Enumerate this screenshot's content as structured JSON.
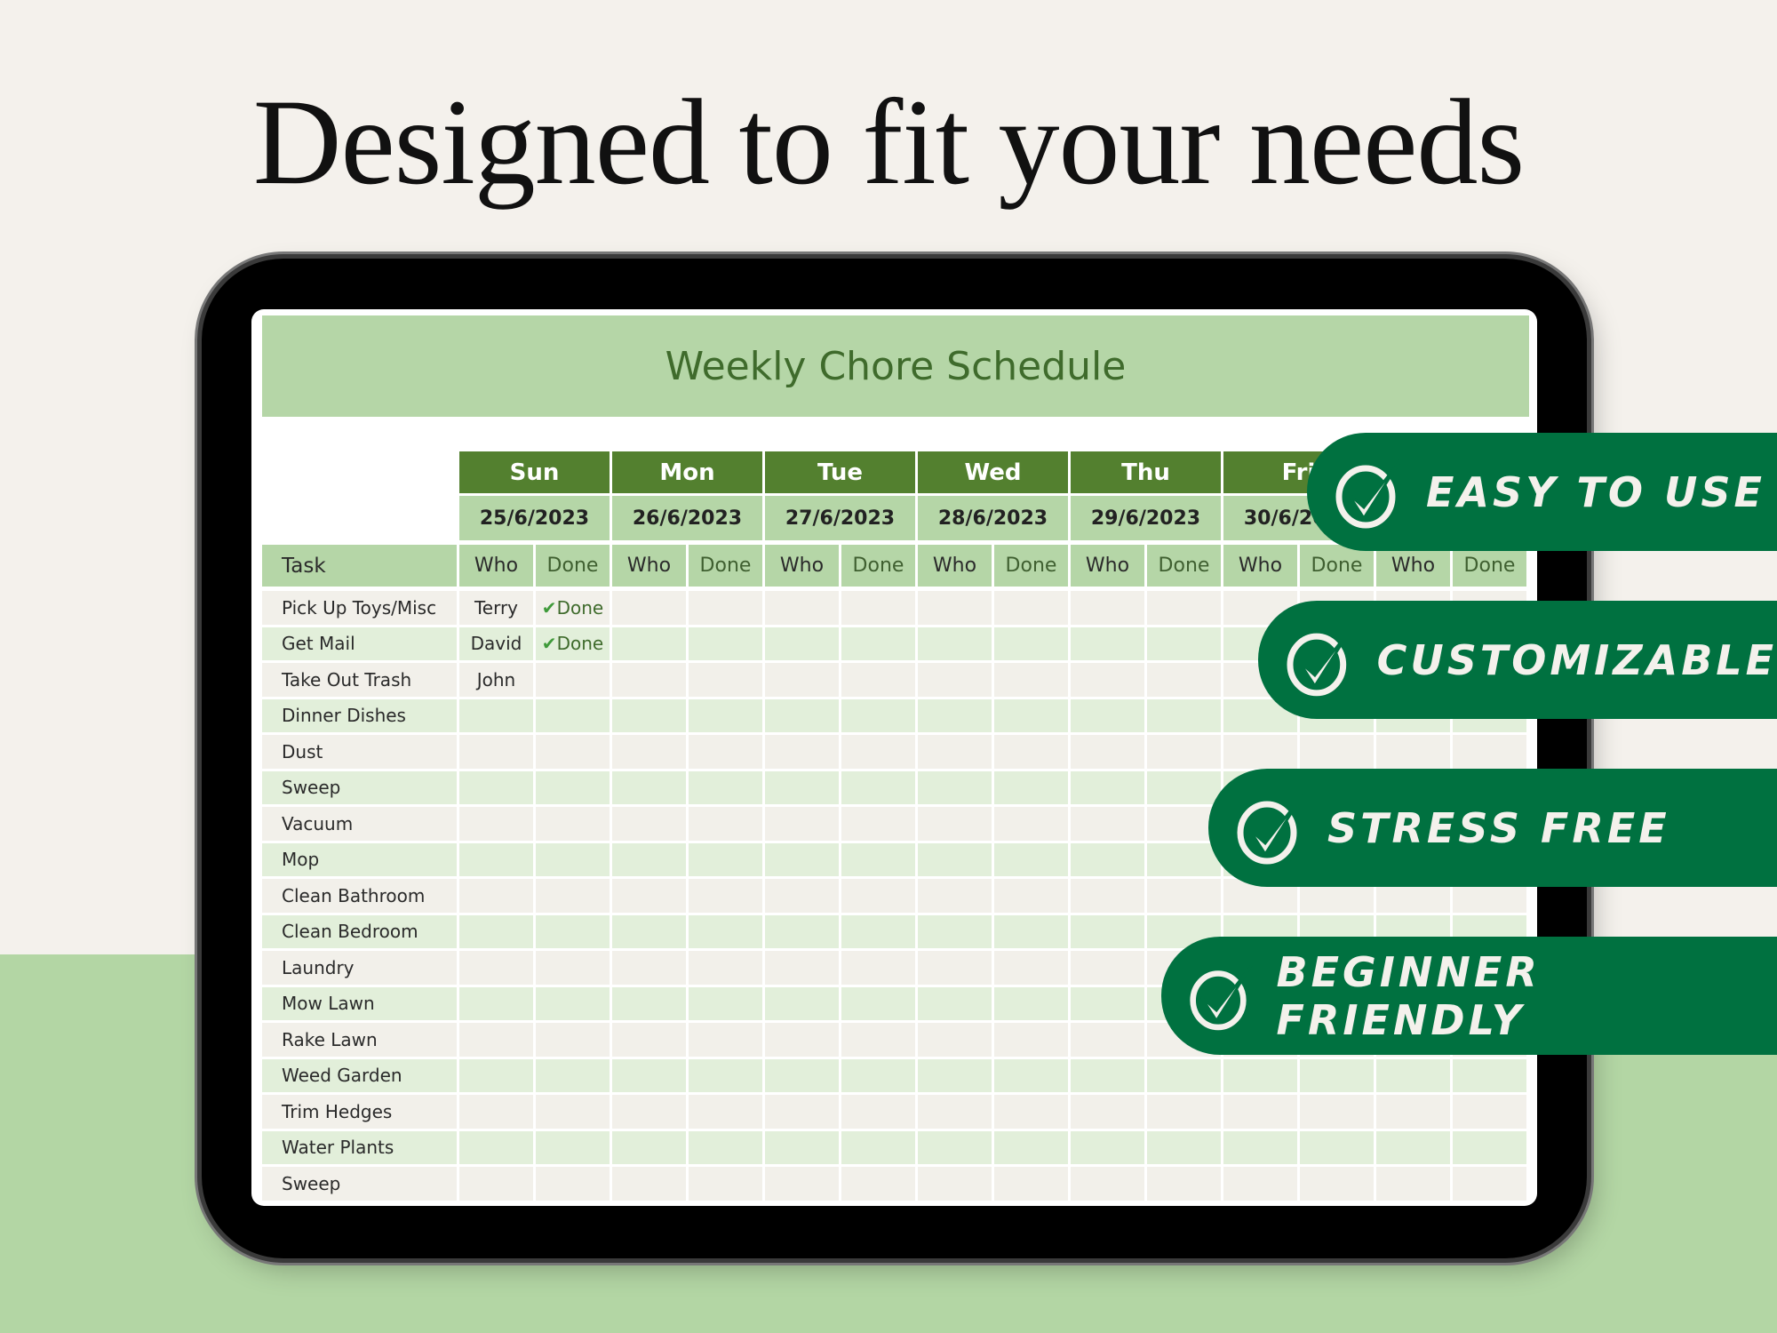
{
  "headline": "Designed to fit your needs",
  "sheet": {
    "title": "Weekly Chore Schedule",
    "task_header": "Task",
    "who_label": "Who",
    "done_label": "Done",
    "days": [
      {
        "day": "Sun",
        "date": "25/6/2023"
      },
      {
        "day": "Mon",
        "date": "26/6/2023"
      },
      {
        "day": "Tue",
        "date": "27/6/2023"
      },
      {
        "day": "Wed",
        "date": "28/6/2023"
      },
      {
        "day": "Thu",
        "date": "29/6/2023"
      },
      {
        "day": "Fri",
        "date": "30/6/2023"
      },
      {
        "day": "",
        "date": ""
      }
    ],
    "rows": [
      {
        "task": "Pick Up Toys/Misc",
        "sun_who": "Terry",
        "sun_done": "Done"
      },
      {
        "task": "Get Mail",
        "sun_who": "David",
        "sun_done": "Done"
      },
      {
        "task": "Take Out Trash",
        "sun_who": "John",
        "sun_done": ""
      },
      {
        "task": "Dinner Dishes"
      },
      {
        "task": "Dust"
      },
      {
        "task": "Sweep"
      },
      {
        "task": "Vacuum"
      },
      {
        "task": "Mop"
      },
      {
        "task": "Clean Bathroom"
      },
      {
        "task": "Clean Bedroom"
      },
      {
        "task": "Laundry"
      },
      {
        "task": "Mow Lawn"
      },
      {
        "task": "Rake Lawn"
      },
      {
        "task": "Weed Garden"
      },
      {
        "task": "Trim Hedges"
      },
      {
        "task": "Water Plants"
      },
      {
        "task": "Sweep"
      }
    ]
  },
  "badges": [
    {
      "label": "EASY TO USE",
      "icon": "check-circle-icon"
    },
    {
      "label": "CUSTOMIZABLE",
      "icon": "check-circle-icon"
    },
    {
      "label": "STRESS FREE",
      "icon": "check-circle-icon"
    },
    {
      "label": "BEGINNER FRIENDLY",
      "icon": "check-circle-icon"
    }
  ],
  "colors": {
    "badge": "#007140",
    "day_header": "#53802f",
    "light_green": "#b5d6a7",
    "row_alt": "#e2efda",
    "row": "#f2f0ea"
  }
}
